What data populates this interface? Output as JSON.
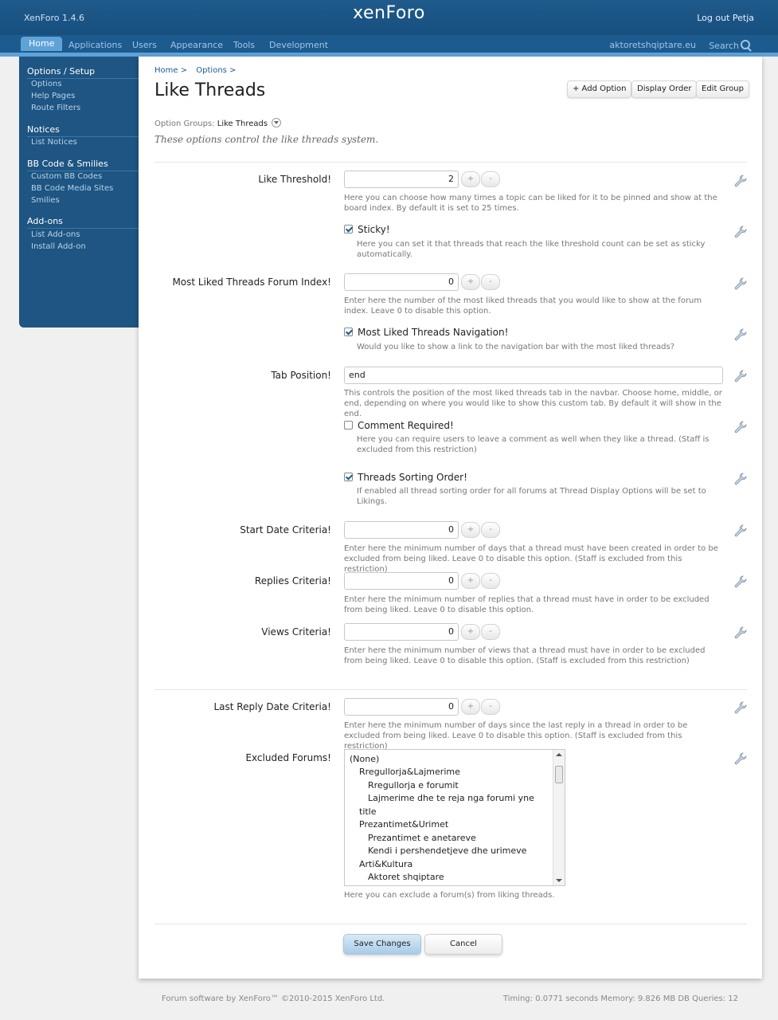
{
  "header": {
    "version": "XenForo 1.4.6",
    "logo": "xenForo",
    "logout": "Log out Petja"
  },
  "nav": {
    "tabs": [
      "Home",
      "Applications",
      "Users",
      "Appearance",
      "Tools",
      "Development"
    ],
    "site_link": "aktoretshqiptare.eu",
    "search": "Search"
  },
  "sidebar": {
    "sections": [
      {
        "heading": "Options / Setup",
        "items": [
          "Options",
          "Help Pages",
          "Route Filters"
        ]
      },
      {
        "heading": "Notices",
        "items": [
          "List Notices"
        ]
      },
      {
        "heading": "BB Code & Smilies",
        "items": [
          "Custom BB Codes",
          "BB Code Media Sites",
          "Smilies"
        ]
      },
      {
        "heading": "Add-ons",
        "items": [
          "List Add-ons",
          "Install Add-on"
        ]
      }
    ]
  },
  "breadcrumb": [
    "Home >",
    "Options >"
  ],
  "page_title": "Like Threads",
  "toolbar": {
    "add_option": "+ Add Option",
    "display_order": "Display Order",
    "edit_group": "Edit Group"
  },
  "option_groups": {
    "label": "Option Groups:",
    "value": "Like Threads"
  },
  "description": "These options control the like threads system.",
  "options": {
    "like_threshold": {
      "label": "Like Threshold!",
      "value": "2",
      "hint": "Here you can choose how many times a topic can be liked for it to be pinned and show at the board index. By default it is set to 25 times."
    },
    "sticky": {
      "label": "Sticky!",
      "checked": true,
      "hint": "Here you can set it that threads that reach the like threshold count can be set as sticky automatically."
    },
    "most_liked_index": {
      "label": "Most Liked Threads Forum Index!",
      "value": "0",
      "hint": "Enter here the number of the most liked threads that you would like to show at the forum index. Leave 0 to disable this option."
    },
    "most_liked_nav": {
      "label": "Most Liked Threads Navigation!",
      "checked": true,
      "hint": "Would you like to show a link to the navigation bar with the most liked threads?"
    },
    "tab_position": {
      "label": "Tab Position!",
      "value": "end",
      "hint": "This controls the position of the most liked threads tab in the navbar. Choose home, middle, or end, depending on where you would like to show this custom tab. By default it will show in the end."
    },
    "comment_required": {
      "label": "Comment Required!",
      "checked": false,
      "hint": "Here you can require users to leave a comment as well when they like a thread. (Staff is excluded from this restriction)"
    },
    "sorting_order": {
      "label": "Threads Sorting Order!",
      "checked": true,
      "hint": "If enabled all thread sorting order for all forums at Thread Display Options will be set to Likings."
    },
    "start_date": {
      "label": "Start Date Criteria!",
      "value": "0",
      "hint": "Enter here the minimum number of days that a thread must have been created in order to be excluded from being liked. Leave 0 to disable this option. (Staff is excluded from this restriction)"
    },
    "replies": {
      "label": "Replies Criteria!",
      "value": "0",
      "hint": "Enter here the minimum number of replies that a thread must have in order to be excluded from being liked. Leave 0 to disable this option."
    },
    "views": {
      "label": "Views Criteria!",
      "value": "0",
      "hint": "Enter here the minimum number of views that a thread must have in order to be excluded from being liked. Leave 0 to disable this option. (Staff is excluded from this restriction)"
    },
    "last_reply": {
      "label": "Last Reply Date Criteria!",
      "value": "0",
      "hint": "Enter here the minimum number of days since the last reply in a thread in order to be excluded from being liked. Leave 0 to disable this option. (Staff is excluded from this restriction)"
    },
    "excluded_forums": {
      "label": "Excluded Forums!",
      "hint": "Here you can exclude a forum(s) from liking threads.",
      "list": [
        {
          "text": "(None)",
          "level": 0
        },
        {
          "text": "Rregullorja&Lajmerime",
          "level": 1
        },
        {
          "text": "Rregullorja e forumit",
          "level": 2
        },
        {
          "text": "Lajmerime dhe te reja nga forumi yne",
          "level": 2
        },
        {
          "text": "title",
          "level": 1
        },
        {
          "text": "Prezantimet&Urimet",
          "level": 1
        },
        {
          "text": "Prezantimet e anetareve",
          "level": 2
        },
        {
          "text": "Kendi i pershendetjeve dhe urimeve",
          "level": 2
        },
        {
          "text": "Arti&Kultura",
          "level": 1
        },
        {
          "text": "Aktoret shqiptare",
          "level": 2
        }
      ]
    }
  },
  "stepper": {
    "plus": "+",
    "minus": "-"
  },
  "buttons": {
    "save": "Save Changes",
    "cancel": "Cancel"
  },
  "footer": {
    "left": "Forum software by XenForo™ ©2010-2015 XenForo Ltd.",
    "right": "Timing: 0.0771 seconds Memory: 9.826 MB DB Queries: 12"
  },
  "colors": {
    "header": "#1f5a8c",
    "nav_accent": "#5fa2d8",
    "sidebar": "#1e5582",
    "link": "#1d5b8e"
  }
}
